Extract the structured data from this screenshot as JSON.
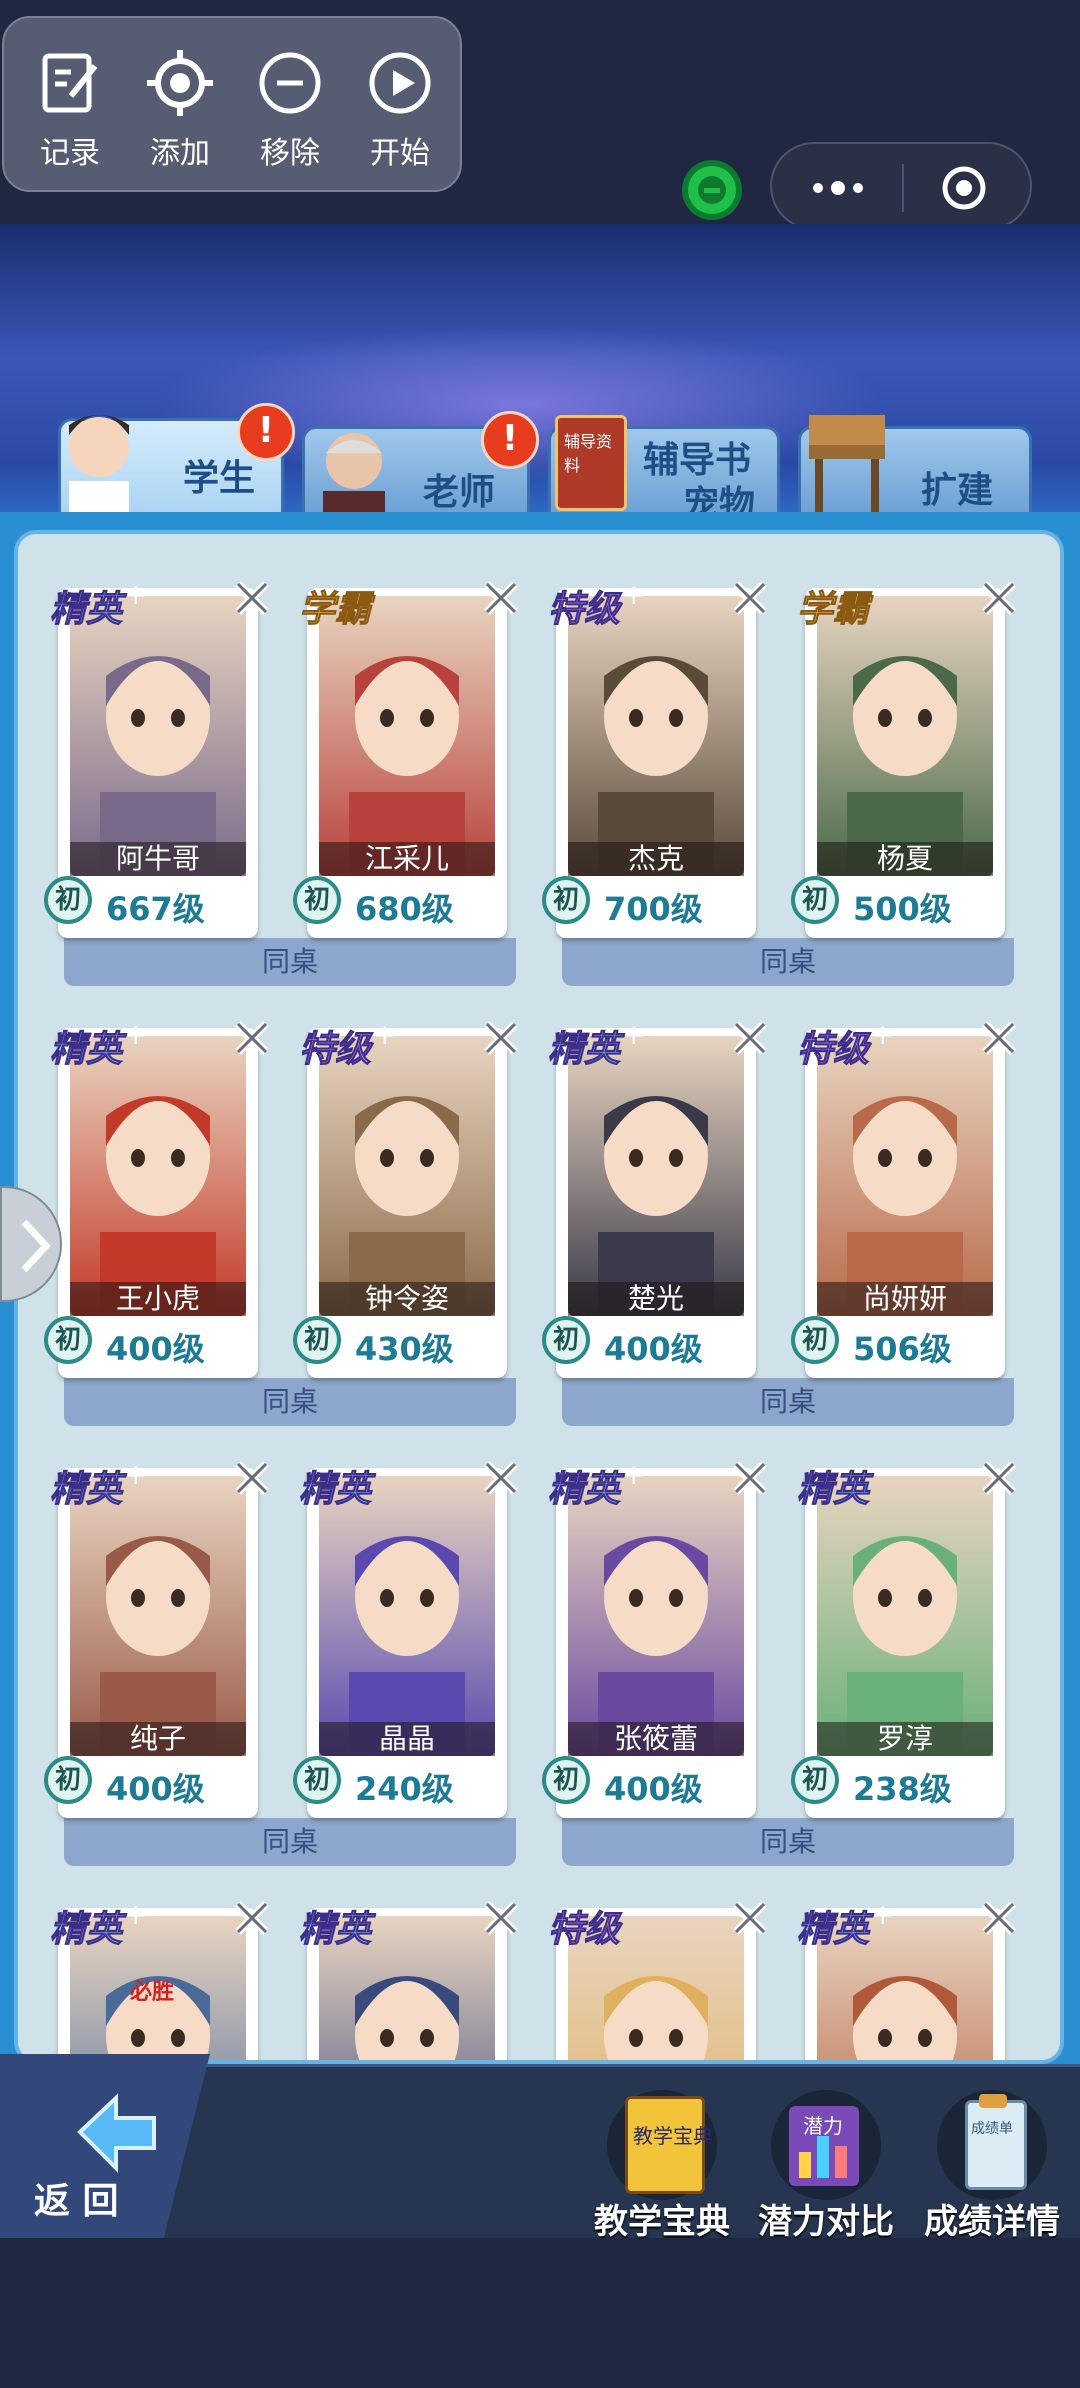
{
  "toolbar": {
    "items": [
      {
        "label": "记录",
        "icon": "edit-icon"
      },
      {
        "label": "添加",
        "icon": "crosshair-icon"
      },
      {
        "label": "移除",
        "icon": "minus-circle-icon"
      },
      {
        "label": "开始",
        "icon": "play-circle-icon"
      }
    ]
  },
  "tabs": [
    {
      "label": "学生",
      "active": true,
      "alert": "!"
    },
    {
      "label": "老师",
      "active": false,
      "alert": "!"
    },
    {
      "label_line1": "辅导书",
      "label_line2": "宠物",
      "book_title": "辅导资料",
      "active": false
    },
    {
      "label": "扩建",
      "active": false
    }
  ],
  "desk_label": "同桌",
  "grade_char": "初",
  "students": [
    {
      "rank": "精英",
      "plus": true,
      "name": "阿牛哥",
      "level": "667级",
      "tone": "#7a6a8a"
    },
    {
      "rank": "学霸",
      "plus": false,
      "name": "江采儿",
      "level": "680级",
      "tone": "#b8423c"
    },
    {
      "rank": "特级",
      "plus": true,
      "name": "杰克",
      "level": "700级",
      "tone": "#5a4a3a"
    },
    {
      "rank": "学霸",
      "plus": false,
      "name": "杨夏",
      "level": "500级",
      "tone": "#4a6a4a"
    },
    {
      "rank": "精英",
      "plus": true,
      "name": "王小虎",
      "level": "400级",
      "tone": "#c43a2a"
    },
    {
      "rank": "特级",
      "plus": true,
      "name": "钟令姿",
      "level": "430级",
      "tone": "#8a6a4a"
    },
    {
      "rank": "精英",
      "plus": true,
      "name": "楚光",
      "level": "400级",
      "tone": "#3a3a4a"
    },
    {
      "rank": "特级",
      "plus": true,
      "name": "尚妍妍",
      "level": "506级",
      "tone": "#b86a4a"
    },
    {
      "rank": "精英",
      "plus": true,
      "name": "纯子",
      "level": "400级",
      "tone": "#9a5a4a"
    },
    {
      "rank": "精英",
      "plus": false,
      "name": "晶晶",
      "level": "240级",
      "tone": "#5a4ab0"
    },
    {
      "rank": "精英",
      "plus": true,
      "name": "张筱蕾",
      "level": "400级",
      "tone": "#6a4aa0"
    },
    {
      "rank": "精英",
      "plus": false,
      "name": "罗淳",
      "level": "238级",
      "tone": "#6ab07a"
    },
    {
      "rank": "精英",
      "plus": true,
      "name": "",
      "level": "",
      "badge": "必胜",
      "tone": "#4a6a9a"
    },
    {
      "rank": "精英",
      "plus": false,
      "name": "",
      "level": "",
      "tone": "#3a4a7a"
    },
    {
      "rank": "特级",
      "plus": false,
      "name": "",
      "level": "",
      "tone": "#e0b060"
    },
    {
      "rank": "精英",
      "plus": true,
      "name": "",
      "level": "",
      "tone": "#b05a3a"
    }
  ],
  "bottom": {
    "back_label": "返 回",
    "buttons": [
      {
        "label": "教学宝典",
        "icon": "book-icon",
        "icon_text": "教学宝典"
      },
      {
        "label": "潜力对比",
        "icon": "bar-chart-icon",
        "icon_text": "潜力"
      },
      {
        "label": "成绩详情",
        "icon": "clipboard-icon",
        "icon_text": "成绩单"
      }
    ]
  }
}
